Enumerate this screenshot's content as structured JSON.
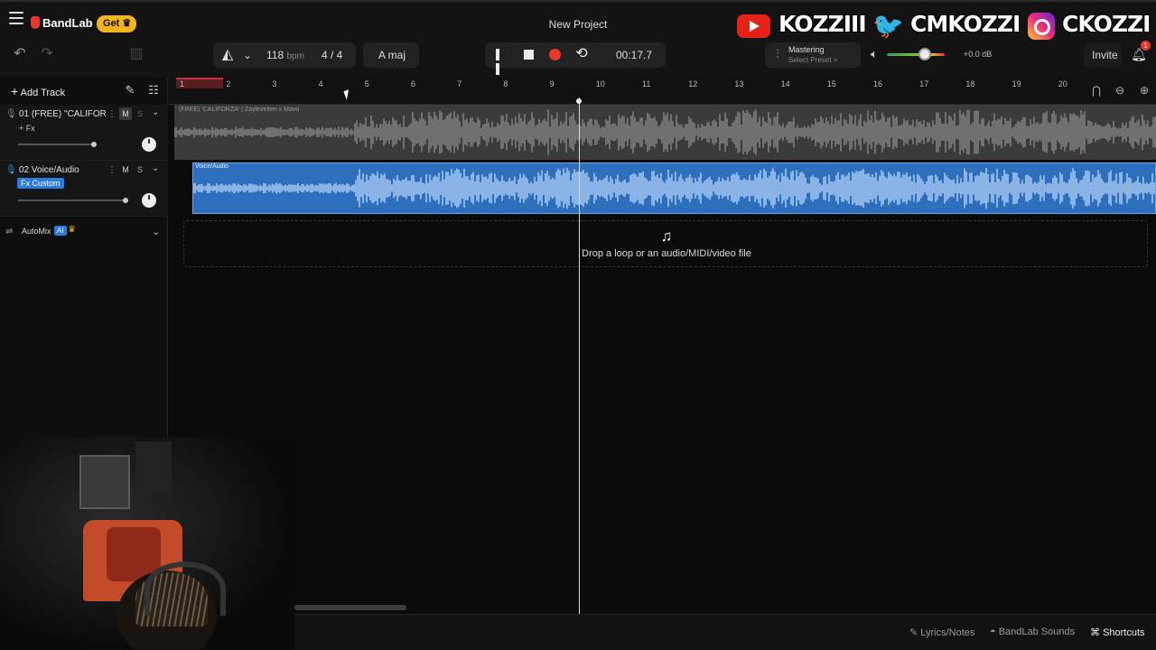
{
  "app": {
    "brand": "BandLab",
    "get_label": "Get",
    "project_title": "New Project"
  },
  "overlay": {
    "youtube": "KOZZIII",
    "twitter": "CMKOZZI",
    "instagram": "CKOZZI"
  },
  "toolbar": {
    "bpm_value": "118",
    "bpm_unit": "bpm",
    "time_signature": "4 / 4",
    "key": "A maj",
    "time": "00:17.7",
    "mastering_label": "Mastering",
    "mastering_preset": "Select Preset >",
    "volume_db": "+0.0 dB",
    "invite_label": "Invite",
    "notifications_count": "1",
    "volume_level": 0.65
  },
  "left_panel": {
    "add_track_label": "Add Track",
    "tracks": [
      {
        "index": "01",
        "name": "(FREE) \"CALIFORZA\" ...",
        "mute": "M",
        "solo": "S",
        "fx": "+ Fx"
      },
      {
        "index": "02",
        "name": "Voice/Audio",
        "mute": "M",
        "solo": "S",
        "fx": "Fx Custom"
      }
    ],
    "automix_label": "AutoMix",
    "automix_badge": "AI"
  },
  "ruler": {
    "ticks": [
      "1",
      "2",
      "3",
      "4",
      "5",
      "6",
      "7",
      "8",
      "9",
      "10",
      "11",
      "12",
      "13",
      "14",
      "15",
      "16",
      "17",
      "18",
      "19",
      "20"
    ]
  },
  "lanes": {
    "track1_region_label": "(FREE) 'CALIFORZA'  |  Zaylevelten x Mavo",
    "track2_region_label": "Voice/Audio",
    "drop_text": "Drop a loop or an audio/MIDI/video file"
  },
  "bottom_bar": {
    "lyrics": "Lyrics/Notes",
    "sounds": "BandLab Sounds",
    "shortcuts": "Shortcuts"
  },
  "icons": {
    "menu": "hamburger-icon",
    "undo": "undo-icon",
    "redo": "redo-icon",
    "metronome": "metronome-icon",
    "pause": "pause-icon",
    "stop": "stop-icon",
    "record": "record-icon",
    "loop": "loop-icon",
    "speaker": "speaker-icon",
    "bell": "bell-icon"
  },
  "colors": {
    "accent_red": "#e8362f",
    "get_yellow": "#f2b41c",
    "audio_blue": "#2e6fbd",
    "fx_blue": "#2d7be0"
  }
}
